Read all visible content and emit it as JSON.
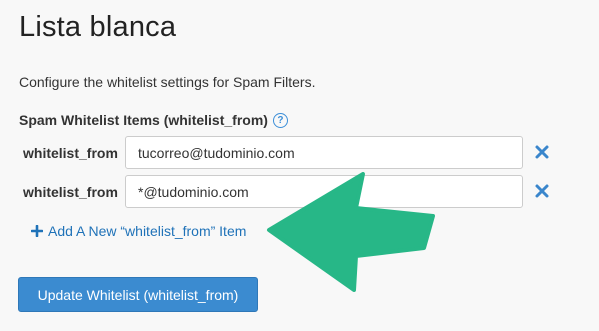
{
  "page": {
    "title": "Lista blanca",
    "description": "Configure the whitelist settings for Spam Filters."
  },
  "whitelist": {
    "heading": "Spam Whitelist Items (whitelist_from)",
    "help_icon": "question-circle-icon",
    "items": [
      {
        "label": "whitelist_from",
        "value": "tucorreo@tudominio.com"
      },
      {
        "label": "whitelist_from",
        "value": "*@tudominio.com"
      }
    ],
    "remove_icon": "close-x-icon",
    "add_item_label": "Add A New “whitelist_from” Item",
    "add_icon": "plus-icon"
  },
  "actions": {
    "update_label": "Update Whitelist (whitelist_from)"
  },
  "annotation": {
    "icon": "arrow-left-icon",
    "color": "#27b787"
  },
  "colors": {
    "link": "#1f72b8",
    "primary_button": "#3b8bd0",
    "remove_icon": "#3a86cc"
  }
}
